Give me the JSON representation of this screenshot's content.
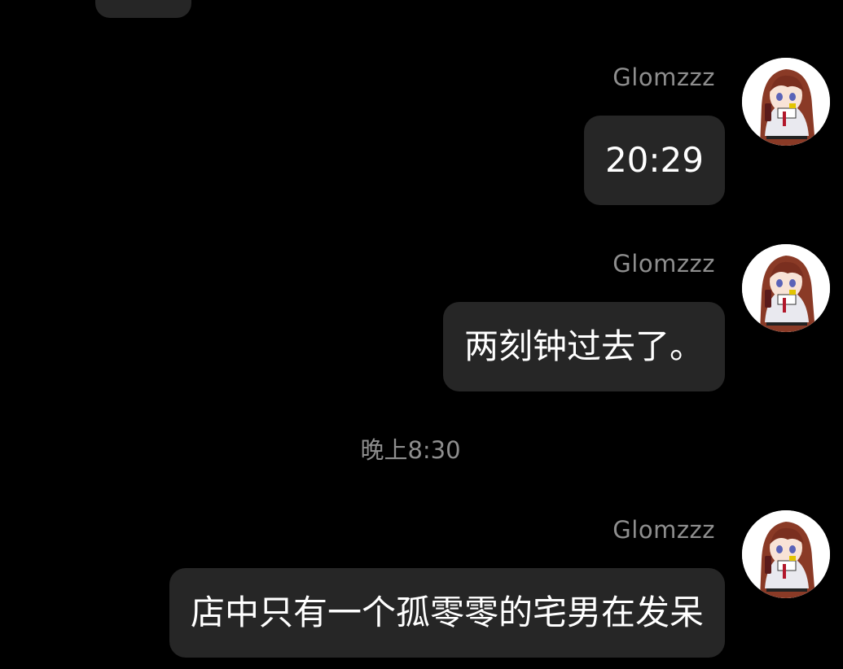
{
  "chat": {
    "messages": [
      {
        "sender": "Glomzzz",
        "text": "20:29",
        "avatar_icon": "anime-girl-avatar-icon"
      },
      {
        "sender": "Glomzzz",
        "text": "两刻钟过去了。",
        "avatar_icon": "anime-girl-avatar-icon"
      },
      {
        "sender": "Glomzzz",
        "text": "店中只有一个孤零零的宅男在发呆",
        "avatar_icon": "anime-girl-avatar-icon"
      }
    ],
    "timestamp": "晚上8:30"
  },
  "colors": {
    "background": "#000000",
    "bubble": "#262626",
    "bubble_text": "#ffffff",
    "meta_text": "#8e8e8e"
  }
}
